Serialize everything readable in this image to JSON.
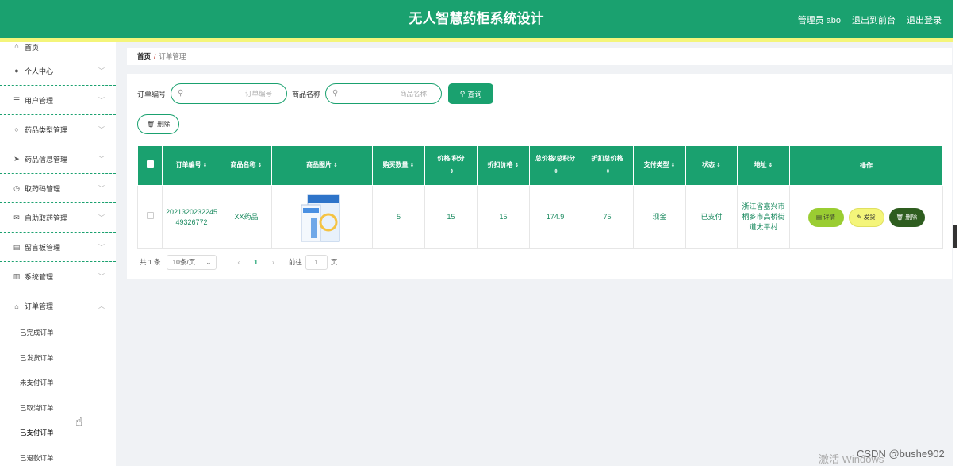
{
  "header": {
    "title": "无人智慧药柜系统设计",
    "admin": "管理员 abo",
    "back_front": "退出到前台",
    "logout": "退出登录"
  },
  "sidebar": {
    "items": [
      {
        "label": "首页",
        "icon": "home-icon"
      },
      {
        "label": "个人中心",
        "icon": "person-icon"
      },
      {
        "label": "用户管理",
        "icon": "sliders-icon"
      },
      {
        "label": "药品类型管理",
        "icon": "power-icon"
      },
      {
        "label": "药品信息管理",
        "icon": "send-icon"
      },
      {
        "label": "取药码管理",
        "icon": "clock-icon"
      },
      {
        "label": "自助取药管理",
        "icon": "mail-icon"
      },
      {
        "label": "留言板管理",
        "icon": "doc-icon"
      },
      {
        "label": "系统管理",
        "icon": "bar-chart-icon"
      },
      {
        "label": "订单管理",
        "icon": "bank-icon"
      }
    ],
    "sub_items": [
      "已完成订单",
      "已发货订单",
      "未支付订单",
      "已取消订单",
      "已支付订单",
      "已退款订单"
    ]
  },
  "breadcrumb": {
    "home": "首页",
    "separator": "/",
    "current": "订单管理"
  },
  "search": {
    "order_label": "订单编号",
    "order_placeholder": "订单编号",
    "name_label": "商品名称",
    "name_placeholder": "商品名称",
    "query_button": "查询",
    "delete_button": "删除"
  },
  "table": {
    "headers": [
      "订单编号",
      "商品名称",
      "商品图片",
      "购买数量",
      "价格/积分",
      "折扣价格",
      "总价格/总积分",
      "折扣总价格",
      "支付类型",
      "状态",
      "地址",
      "操作"
    ],
    "rows": [
      {
        "order_no": "202132023224549326772",
        "name": "XX药品",
        "qty": "5",
        "price": "15",
        "discount_price": "15",
        "total": "174.9",
        "discount_total": "75",
        "pay_type": "现金",
        "status": "已支付",
        "address": "浙江省嘉兴市桐乡市高桥街道太平村"
      }
    ],
    "actions": {
      "detail": "详情",
      "ship": "发货",
      "delete": "删除"
    }
  },
  "pager": {
    "total": "共 1 条",
    "page_size": "10条/页",
    "current": "1",
    "goto_label": "前往",
    "goto_value": "1",
    "page_suffix": "页"
  },
  "watermark": "激活 Windows",
  "csdn": "CSDN @bushe902",
  "colors": {
    "primary": "#1aa16f",
    "yellow": "#f4f57a",
    "detail": "#9acd32",
    "delete": "#2e5d1f"
  }
}
